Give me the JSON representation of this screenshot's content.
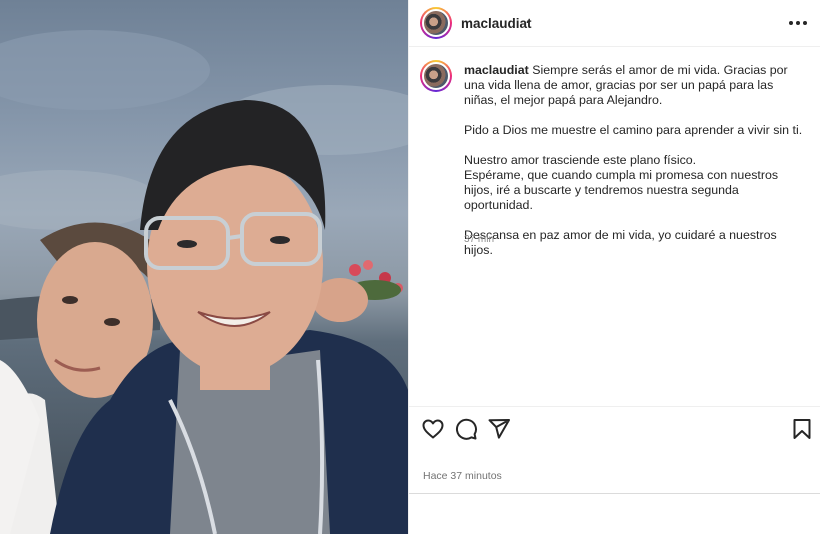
{
  "post": {
    "username": "maclaudiat",
    "header_separator": "·",
    "caption": {
      "username": "maclaudiat",
      "paragraphs": [
        "Siempre serás el amor de mi vida. Gracias por una vida llena de amor, gracias por ser un papá para las niñas, el mejor papá para Alejandro.",
        "Pido a Dios me muestre el camino para aprender a vivir sin ti.",
        "Nuestro amor trasciende este plano físico.",
        "Espérame, que cuando cumpla mi promesa con nuestros hijos, iré a buscarte y tendremos nuestra segunda oportunidad.",
        "Descansa en paz amor de mi vida, yo cuidaré a nuestros hijos."
      ],
      "relative_time": "37 min"
    },
    "timestamp": "Hace 37 minutos"
  },
  "icons": {
    "more": "more-options-icon",
    "like": "heart-icon",
    "comment": "comment-icon",
    "share": "send-icon",
    "save": "bookmark-icon"
  },
  "colors": {
    "text": "#262626",
    "muted": "#8e8e8e",
    "divider": "#efefef",
    "story_ring": [
      "#f9ce34",
      "#ee2a7b",
      "#6228d7"
    ]
  }
}
